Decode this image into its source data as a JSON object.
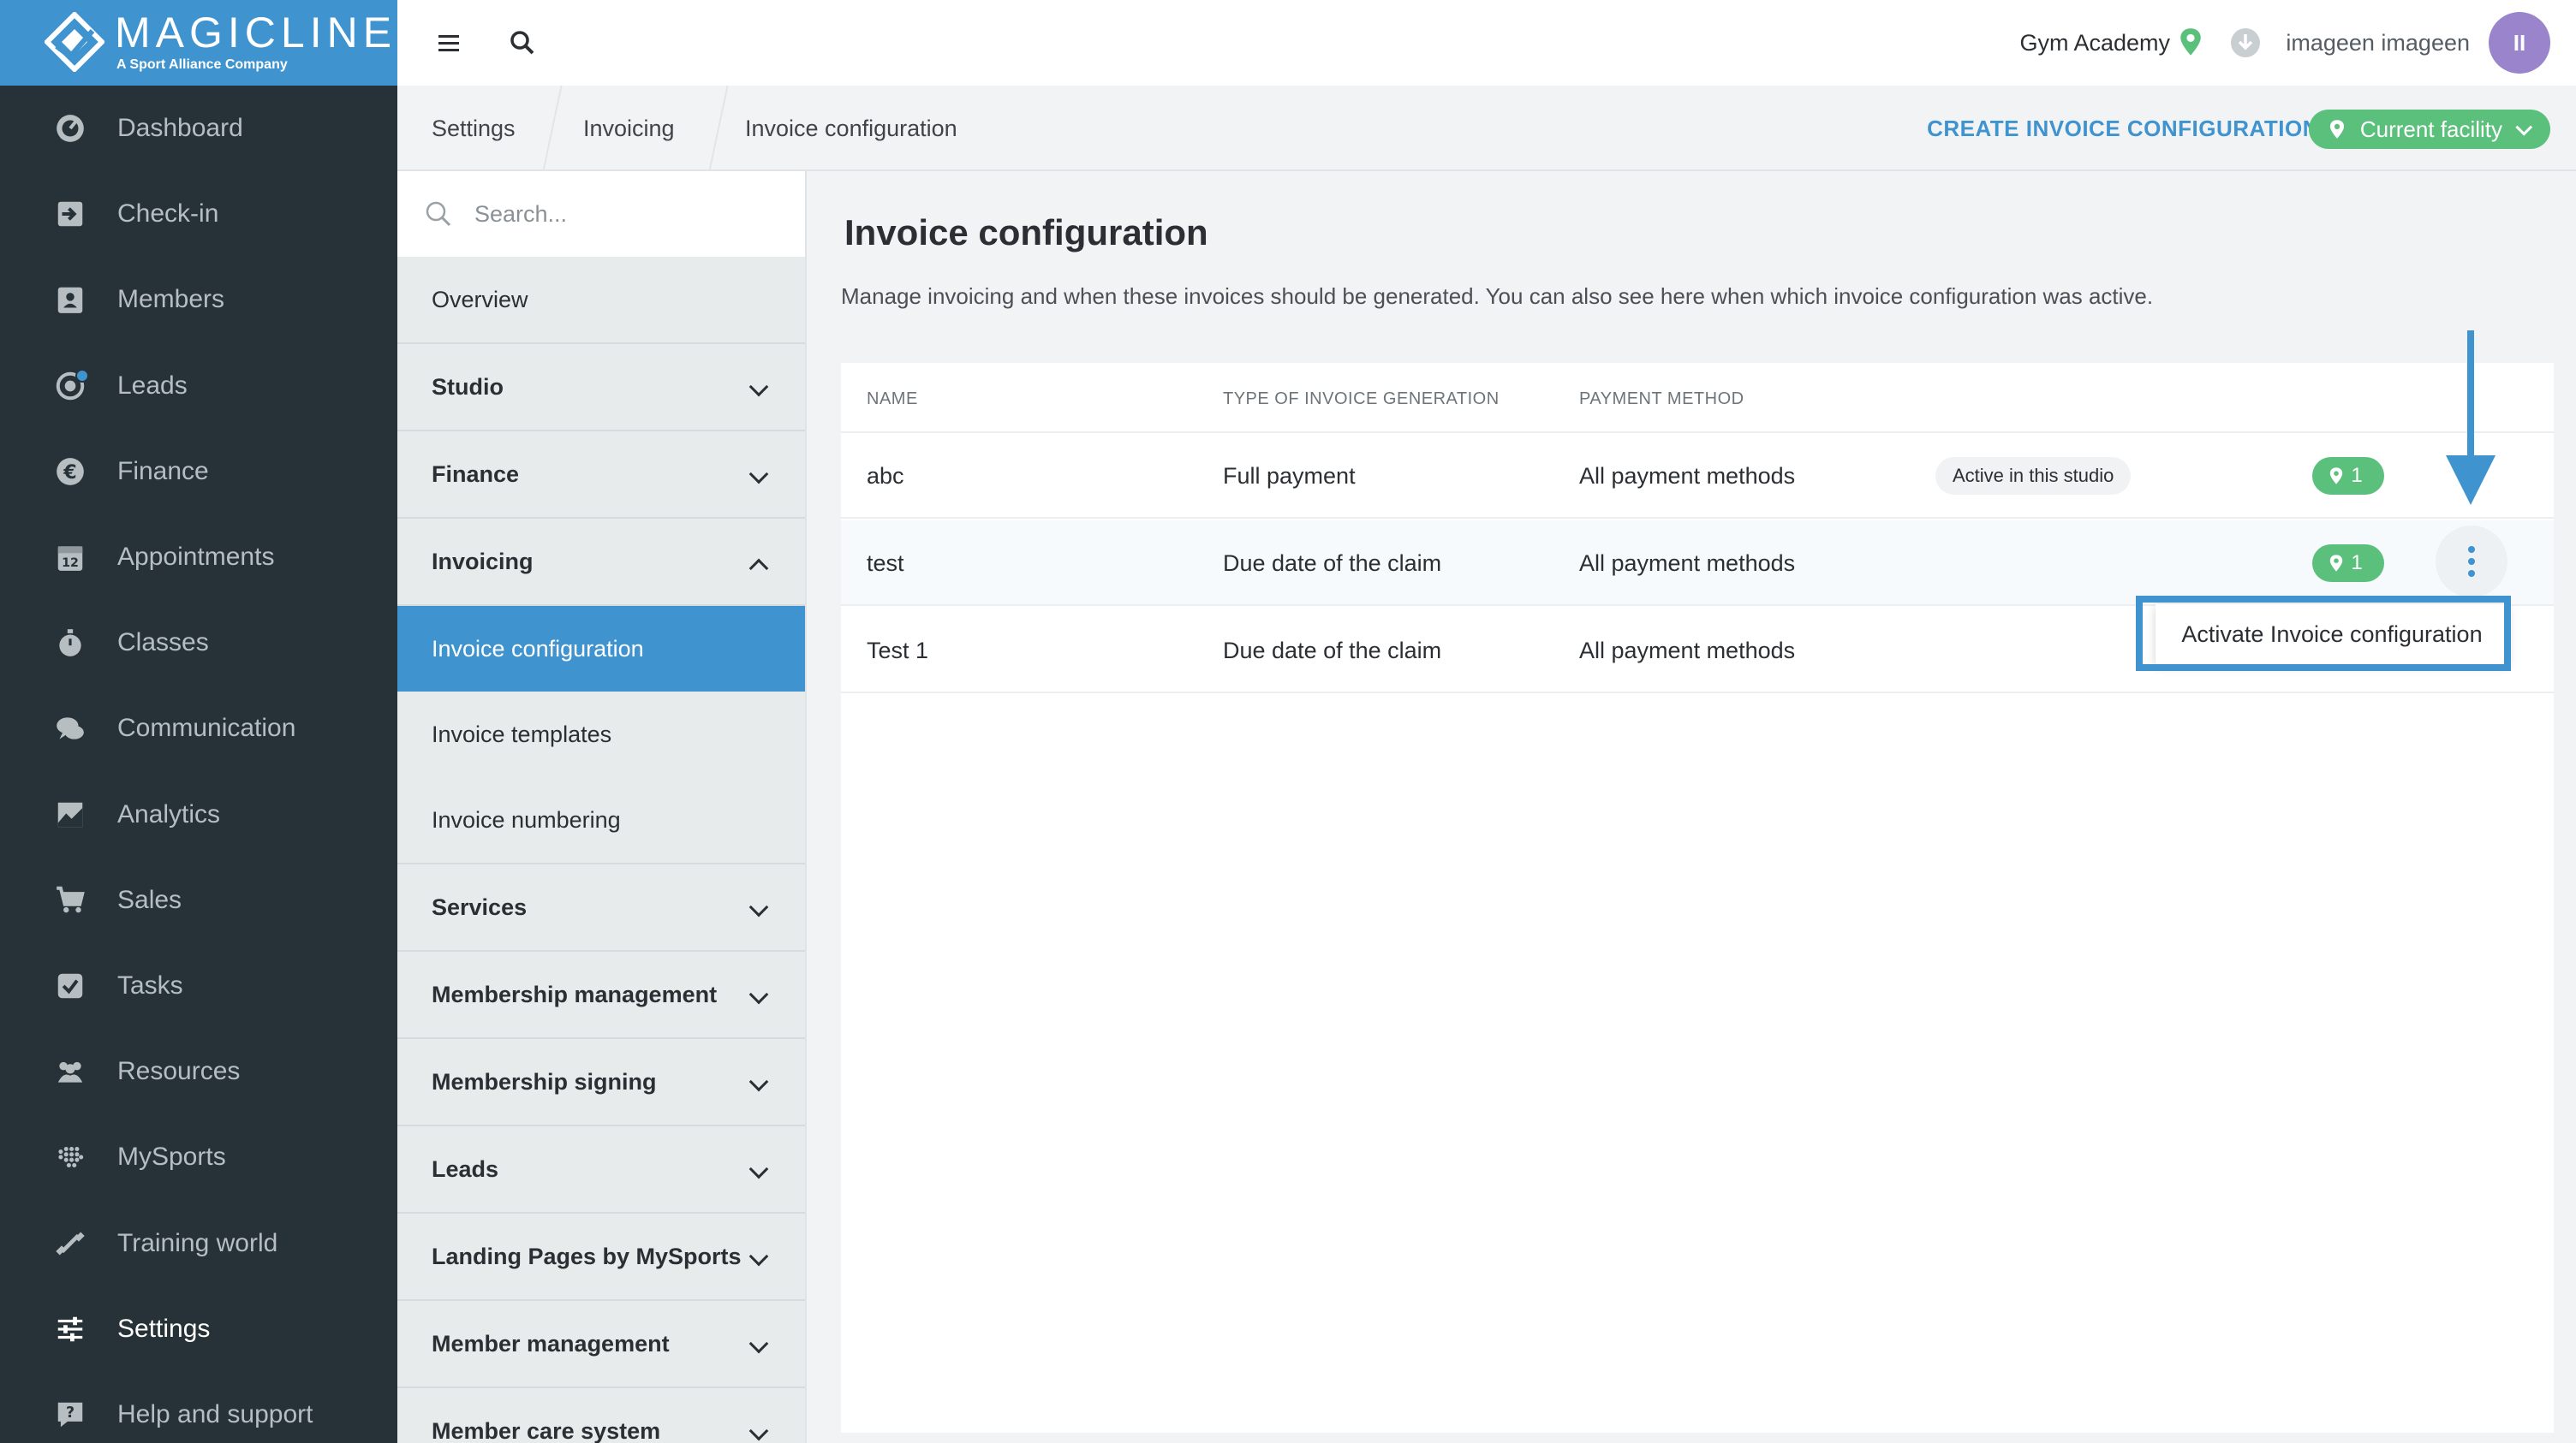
{
  "brand": {
    "name": "MAGICLINE",
    "tagline": "A Sport Alliance Company"
  },
  "nav": [
    {
      "label": "Dashboard",
      "icon": "dashboard-icon"
    },
    {
      "label": "Check-in",
      "icon": "check-in-icon"
    },
    {
      "label": "Members",
      "icon": "members-icon"
    },
    {
      "label": "Leads",
      "icon": "leads-icon",
      "has_badge": true
    },
    {
      "label": "Finance",
      "icon": "euro-icon"
    },
    {
      "label": "Appointments",
      "icon": "calendar-icon"
    },
    {
      "label": "Classes",
      "icon": "stopwatch-icon"
    },
    {
      "label": "Communication",
      "icon": "chat-icon"
    },
    {
      "label": "Analytics",
      "icon": "chart-icon"
    },
    {
      "label": "Sales",
      "icon": "cart-icon"
    },
    {
      "label": "Tasks",
      "icon": "checkbox-icon"
    },
    {
      "label": "Resources",
      "icon": "people-icon"
    },
    {
      "label": "MySports",
      "icon": "dots-grid-icon"
    },
    {
      "label": "Training world",
      "icon": "dumbbell-icon"
    },
    {
      "label": "Settings",
      "icon": "sliders-icon",
      "active": true
    },
    {
      "label": "Help and support",
      "icon": "help-icon"
    }
  ],
  "topbar": {
    "facility": "Gym Academy",
    "user": "imageen imageen",
    "avatar_initials": "II"
  },
  "breadcrumb": [
    "Settings",
    "Invoicing",
    "Invoice configuration"
  ],
  "actions": {
    "create_label": "CREATE INVOICE CONFIGURATION",
    "facility_filter": "Current facility"
  },
  "submenu": {
    "search_placeholder": "Search...",
    "overview": "Overview",
    "studio": "Studio",
    "finance": "Finance",
    "invoicing": "Invoicing",
    "invoicing_children": [
      "Invoice configuration",
      "Invoice templates",
      "Invoice numbering"
    ],
    "services": "Services",
    "membership_management": "Membership management",
    "membership_signing": "Membership signing",
    "leads": "Leads",
    "landing_pages": "Landing Pages by MySports",
    "member_management": "Member management",
    "member_care": "Member care system"
  },
  "page": {
    "title": "Invoice configuration",
    "description": "Manage invoicing and when these invoices should be generated. You can also see here when which invoice configuration was active."
  },
  "table": {
    "headers": [
      "NAME",
      "TYPE OF INVOICE GENERATION",
      "PAYMENT METHOD"
    ],
    "rows": [
      {
        "name": "abc",
        "type": "Full payment",
        "payment": "All payment methods",
        "status": "Active in this studio",
        "facilities": "1"
      },
      {
        "name": "test",
        "type": "Due date of the claim",
        "payment": "All payment methods",
        "status": "",
        "facilities": "1"
      },
      {
        "name": "Test 1",
        "type": "Due date of the claim",
        "payment": "All payment methods",
        "status": "",
        "facilities": ""
      }
    ]
  },
  "context_menu": {
    "item": "Activate Invoice configuration"
  },
  "colors": {
    "accent": "#3f93cf",
    "sidebar": "#263238",
    "success": "#5cc07d",
    "avatar": "#9a85cc"
  }
}
